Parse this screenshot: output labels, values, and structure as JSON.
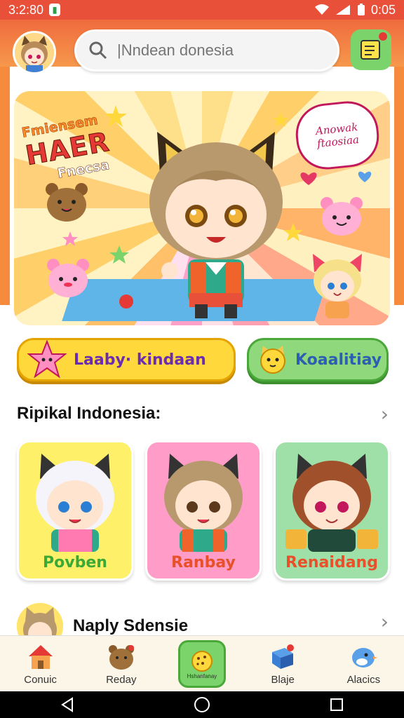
{
  "status_bar": {
    "time": "3:2:80",
    "battery_time": "0:05"
  },
  "header": {
    "search_placeholder": "|Nndean donesia"
  },
  "banner": {
    "title_line1": "Fmiensem",
    "title_line2": "HAER",
    "title_line3": "Fnecsa",
    "bubble_line1": "Anowak",
    "bubble_line2": "ftaosiaa"
  },
  "quick_buttons": [
    {
      "label": "Laaby· kindaan",
      "icon": "star-bear-icon"
    },
    {
      "label": "Koaalitiay",
      "icon": "cat-face-icon"
    }
  ],
  "section": {
    "title": "Ripikal Indonesia:"
  },
  "cards": [
    {
      "label": "Povben"
    },
    {
      "label": "Ranbay"
    },
    {
      "label": "Renaidang"
    }
  ],
  "section2": {
    "title": "Naply Sdensie"
  },
  "bottom_nav": [
    {
      "label": "Conuic",
      "icon": "house-icon"
    },
    {
      "label": "Reday",
      "icon": "bear-icon"
    },
    {
      "label": "Hshanfanay",
      "icon": "cookie-icon"
    },
    {
      "label": "Blaje",
      "icon": "gift-box-icon"
    },
    {
      "label": "Alacics",
      "icon": "bird-icon"
    }
  ],
  "colors": {
    "accent": "#e8503a",
    "green": "#7bd36b",
    "yellow": "#ffd83b"
  }
}
